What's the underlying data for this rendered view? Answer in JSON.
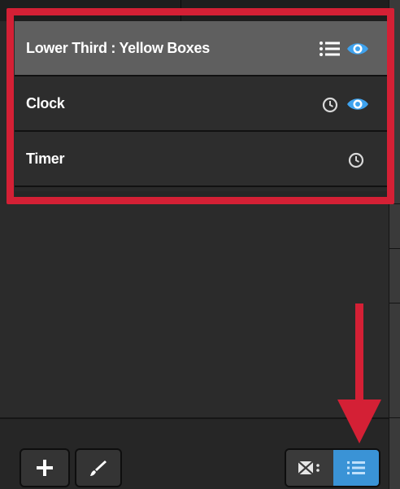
{
  "layers": [
    {
      "label": "Lower Third : Yellow Boxes",
      "selected": true,
      "icons": [
        "list-icon",
        "eye-icon"
      ]
    },
    {
      "label": "Clock",
      "selected": false,
      "icons": [
        "clock-icon",
        "eye-icon"
      ]
    },
    {
      "label": "Timer",
      "selected": false,
      "icons": [
        "clock-icon"
      ]
    }
  ],
  "footer": {
    "add_icon": "plus-icon",
    "edit_icon": "brush-icon",
    "view_toggle": {
      "options": [
        "grid-view-icon",
        "list-view-icon"
      ],
      "active": "list-view-icon"
    }
  },
  "colors": {
    "highlight_border": "#d42035",
    "eye_active": "#3fa3ef",
    "toggle_active": "#3a93d6",
    "selected_row": "#5f5f5f"
  }
}
